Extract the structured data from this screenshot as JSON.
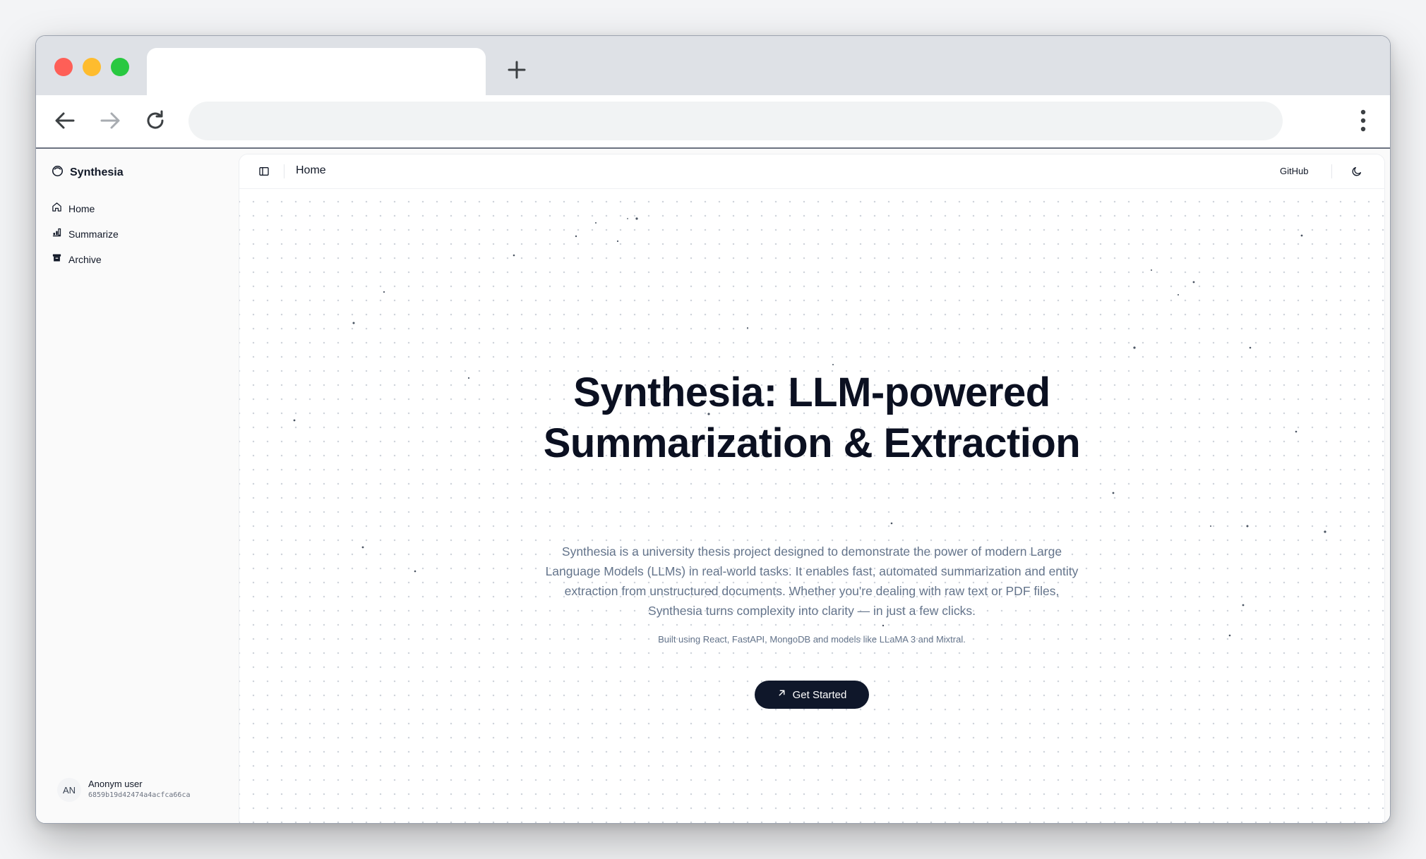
{
  "browser": {
    "tab_title": "",
    "url": ""
  },
  "sidebar": {
    "brand": "Synthesia",
    "items": [
      {
        "label": "Home",
        "icon": "home-icon"
      },
      {
        "label": "Summarize",
        "icon": "summarize-icon"
      },
      {
        "label": "Archive",
        "icon": "archive-icon"
      }
    ],
    "user": {
      "initials": "AN",
      "name": "Anonym user",
      "id": "6859b19d42474a4acfca66ca"
    }
  },
  "header": {
    "breadcrumb": "Home",
    "github_label": "GitHub"
  },
  "hero": {
    "title": "Synthesia: LLM-powered Summarization & Extraction",
    "description": "Synthesia is a university thesis project designed to demonstrate the power of modern Large Language Models (LLMs) in real-world tasks. It enables fast, automated summarization and entity extraction from unstructured documents. Whether you're dealing with raw text or PDF files, Synthesia turns complexity into clarity — in just a few clicks.",
    "built_with": "Built using React, FastAPI, MongoDB and models like LLaMA 3 and Mixtral.",
    "cta_label": "Get Started"
  },
  "colors": {
    "primary": "#0f172a",
    "text": "#111827",
    "muted": "#64748b",
    "sidebar_bg": "#fafafa"
  }
}
